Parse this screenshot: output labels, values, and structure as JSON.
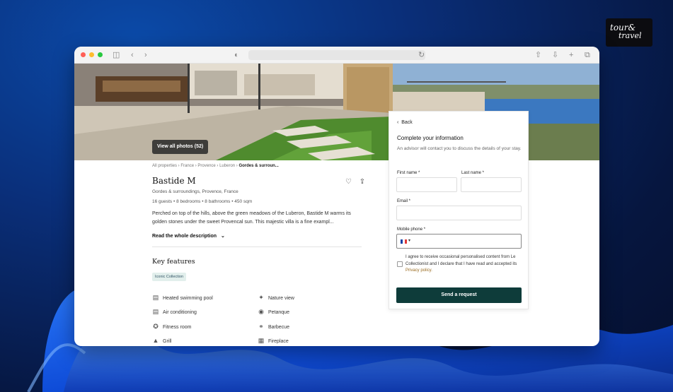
{
  "brand": {
    "line1": "tour&",
    "line2": "travel"
  },
  "browser": {
    "colors": {
      "close": "#ff5f57",
      "min": "#febc2e",
      "max": "#28c840"
    }
  },
  "hero": {
    "view_photos": "View all photos (52)"
  },
  "breadcrumb": [
    "All properties",
    "France",
    "Provence",
    "Luberon",
    "Gordes & surroun..."
  ],
  "property": {
    "title": "Bastide M",
    "location": "Gordes & surroundings,  Provence,  France",
    "stats": "16 guests  •  8 bedrooms  •  8 bathrooms  •  450 sqm",
    "description": "Perched on top of the hills, above the green meadows of the Luberon, Bastide M warms its golden stones under the sweet Provencal sun. This majestic villa is a fine exampl...",
    "read_more": "Read the whole description"
  },
  "key_features": {
    "title": "Key features",
    "tag": "Iconic Collection",
    "items": [
      {
        "label": "Heated swimming pool",
        "icon": "pool-icon"
      },
      {
        "label": "Nature view",
        "icon": "nature-icon"
      },
      {
        "label": "Air conditioning",
        "icon": "ac-icon"
      },
      {
        "label": "Petanque",
        "icon": "petanque-icon"
      },
      {
        "label": "Fitness room",
        "icon": "fitness-icon"
      },
      {
        "label": "Barbecue",
        "icon": "barbecue-icon"
      },
      {
        "label": "Grill",
        "icon": "grill-icon"
      },
      {
        "label": "Fireplace",
        "icon": "fireplace-icon"
      }
    ]
  },
  "form": {
    "back": "Back",
    "title": "Complete your information",
    "subtitle": "An advisor will contact you to discuss the details of your stay.",
    "first_name": "First name *",
    "last_name": "Last name *",
    "email": "Email *",
    "mobile": "Mobile phone *",
    "consent_text": "I agree to receive occasional personalised content from Le Collectionist and I declare that I have read and accepted its",
    "privacy": "Privacy policy.",
    "submit": "Send a request",
    "accent": "#0e3c3a"
  }
}
